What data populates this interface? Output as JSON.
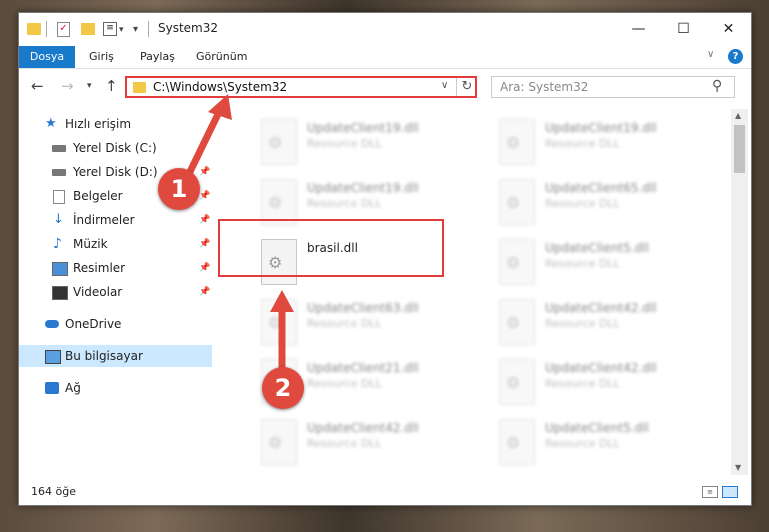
{
  "titlebar": {
    "title": "System32",
    "minimize": "—",
    "maximize": "☐",
    "close": "✕"
  },
  "ribbon": {
    "tabs": [
      "Dosya",
      "Giriş",
      "Paylaş",
      "Görünüm"
    ],
    "help": "?"
  },
  "address": {
    "path": "C:\\Windows\\System32",
    "refresh": "↻"
  },
  "search": {
    "placeholder": "Ara: System32"
  },
  "sidebar": {
    "items": [
      {
        "label": "Hızlı erişim",
        "icon": "star-icon",
        "pinned": false
      },
      {
        "label": "Yerel Disk (C:)",
        "icon": "drive-icon",
        "pinned": false
      },
      {
        "label": "Yerel Disk (D:)",
        "icon": "drive-icon",
        "pinned": true
      },
      {
        "label": "Belgeler",
        "icon": "document-icon",
        "pinned": true
      },
      {
        "label": "İndirmeler",
        "icon": "download-icon",
        "pinned": true
      },
      {
        "label": "Müzik",
        "icon": "music-icon",
        "pinned": true
      },
      {
        "label": "Resimler",
        "icon": "pictures-icon",
        "pinned": true
      },
      {
        "label": "Videolar",
        "icon": "video-icon",
        "pinned": true
      },
      {
        "label": "OneDrive",
        "icon": "cloud-icon",
        "pinned": false
      },
      {
        "label": "Bu bilgisayar",
        "icon": "computer-icon",
        "pinned": false,
        "selected": true
      },
      {
        "label": "Ağ",
        "icon": "network-icon",
        "pinned": false
      }
    ]
  },
  "files": [
    {
      "name": "UpdateClient19.dll",
      "desc": "Resource DLL"
    },
    {
      "name": "UpdateClient19.dll",
      "desc": "Resource DLL"
    },
    {
      "name": "UpdateClient19.dll",
      "desc": "Resource DLL"
    },
    {
      "name": "UpdateClient65.dll",
      "desc": "Resource DLL"
    },
    {
      "name": "brasil.dll",
      "desc": ""
    },
    {
      "name": "UpdateClient5.dll",
      "desc": "Resource DLL"
    },
    {
      "name": "UpdateClient63.dll",
      "desc": "Resource DLL"
    },
    {
      "name": "UpdateClient42.dll",
      "desc": "Resource DLL"
    },
    {
      "name": "UpdateClient21.dll",
      "desc": "Resource DLL"
    },
    {
      "name": "UpdateClient42.dll",
      "desc": "Resource DLL"
    },
    {
      "name": "UpdateClient42.dll",
      "desc": "Resource DLL"
    },
    {
      "name": "UpdateClient5.dll",
      "desc": "Resource DLL"
    }
  ],
  "status": {
    "count": "164 öğe"
  },
  "annotations": {
    "step1": "1",
    "step2": "2",
    "color": "#e04a3e"
  }
}
